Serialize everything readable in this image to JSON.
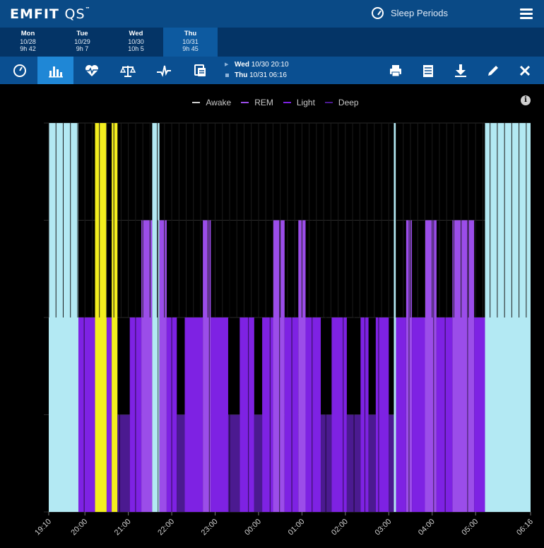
{
  "app": {
    "logo_main": "EMFIT",
    "logo_sub": "QS",
    "logo_tm": "™"
  },
  "header": {
    "periods_label": "Sleep Periods"
  },
  "days": [
    {
      "name": "Mon",
      "date": "10/28",
      "duration": "9h 42",
      "active": false
    },
    {
      "name": "Tue",
      "date": "10/29",
      "duration": "9h 7",
      "active": false
    },
    {
      "name": "Wed",
      "date": "10/30",
      "duration": "10h 5",
      "active": false
    },
    {
      "name": "Thu",
      "date": "10/31",
      "duration": "9h 45",
      "active": true
    }
  ],
  "toolbar": {
    "tools": [
      {
        "icon": "dashboard-gauge-icon",
        "active": false
      },
      {
        "icon": "bar-chart-icon",
        "active": true
      },
      {
        "icon": "heart-rate-icon",
        "active": false
      },
      {
        "icon": "balance-scale-icon",
        "active": false
      },
      {
        "icon": "hrv-wave-icon",
        "active": false
      },
      {
        "icon": "compare-icon",
        "active": false
      }
    ],
    "range": {
      "start": "Wed 10/30 20:10",
      "end": "Thu 10/31 06:16",
      "start_day": "Wed",
      "start_rest": "10/30 20:10",
      "end_day": "Thu",
      "end_rest": "10/31 06:16"
    },
    "actions": [
      "print-icon",
      "notes-icon",
      "download-icon",
      "edit-icon",
      "close-icon"
    ]
  },
  "colors": {
    "awake": "#b3e9f3",
    "rem": "#9b4de9",
    "light": "#7e22e3",
    "deep": "#4b1a90",
    "move": "#f3ee1e",
    "header": "#0a4a86",
    "days_bg": "#043466",
    "active_tool": "#1f87d6"
  },
  "chart_data": {
    "type": "bar",
    "legend": [
      "Awake",
      "REM",
      "Light",
      "Deep"
    ],
    "legend_position": "top-center",
    "x_ticks": [
      "19:10",
      "20:00",
      "21:00",
      "22:00",
      "23:00",
      "00:00",
      "01:00",
      "02:00",
      "03:00",
      "04:00",
      "05:00",
      "06:16"
    ],
    "x_range": [
      "19:10",
      "06:16"
    ],
    "stage_levels": {
      "awake": 4,
      "rem": 3,
      "light": 2,
      "deep": 1
    },
    "grid": true,
    "segments": [
      {
        "start": "19:10",
        "end": "19:51",
        "stage": "awake"
      },
      {
        "start": "19:51",
        "end": "20:14",
        "stage": "light"
      },
      {
        "start": "20:14",
        "end": "20:30",
        "stage": "movement"
      },
      {
        "start": "20:30",
        "end": "20:37",
        "stage": "light"
      },
      {
        "start": "20:37",
        "end": "20:45",
        "stage": "movement"
      },
      {
        "start": "20:45",
        "end": "21:02",
        "stage": "deep"
      },
      {
        "start": "21:02",
        "end": "21:18",
        "stage": "light"
      },
      {
        "start": "21:18",
        "end": "21:33",
        "stage": "rem"
      },
      {
        "start": "21:33",
        "end": "21:43",
        "stage": "awake"
      },
      {
        "start": "21:43",
        "end": "21:53",
        "stage": "rem"
      },
      {
        "start": "21:53",
        "end": "22:07",
        "stage": "light"
      },
      {
        "start": "22:07",
        "end": "22:18",
        "stage": "deep"
      },
      {
        "start": "22:18",
        "end": "22:43",
        "stage": "light"
      },
      {
        "start": "22:43",
        "end": "22:54",
        "stage": "rem"
      },
      {
        "start": "22:54",
        "end": "23:18",
        "stage": "light"
      },
      {
        "start": "23:18",
        "end": "23:34",
        "stage": "deep"
      },
      {
        "start": "23:34",
        "end": "23:54",
        "stage": "light"
      },
      {
        "start": "23:54",
        "end": "24:05",
        "stage": "deep"
      },
      {
        "start": "24:05",
        "end": "24:20",
        "stage": "light"
      },
      {
        "start": "24:20",
        "end": "24:36",
        "stage": "rem"
      },
      {
        "start": "24:36",
        "end": "24:55",
        "stage": "light"
      },
      {
        "start": "24:55",
        "end": "25:05",
        "stage": "rem"
      },
      {
        "start": "25:05",
        "end": "25:26",
        "stage": "light"
      },
      {
        "start": "25:26",
        "end": "25:41",
        "stage": "deep"
      },
      {
        "start": "25:41",
        "end": "26:02",
        "stage": "light"
      },
      {
        "start": "26:02",
        "end": "26:21",
        "stage": "deep"
      },
      {
        "start": "26:21",
        "end": "26:32",
        "stage": "light"
      },
      {
        "start": "26:32",
        "end": "26:42",
        "stage": "deep"
      },
      {
        "start": "26:42",
        "end": "27:00",
        "stage": "light"
      },
      {
        "start": "27:00",
        "end": "27:07",
        "stage": "deep"
      },
      {
        "start": "27:07",
        "end": "27:10",
        "stage": "awake"
      },
      {
        "start": "27:10",
        "end": "27:24",
        "stage": "light"
      },
      {
        "start": "27:24",
        "end": "27:32",
        "stage": "rem"
      },
      {
        "start": "27:32",
        "end": "27:50",
        "stage": "light"
      },
      {
        "start": "27:50",
        "end": "28:06",
        "stage": "rem"
      },
      {
        "start": "28:06",
        "end": "28:28",
        "stage": "light"
      },
      {
        "start": "28:28",
        "end": "28:58",
        "stage": "rem"
      },
      {
        "start": "28:58",
        "end": "29:13",
        "stage": "light"
      },
      {
        "start": "29:13",
        "end": "30:16",
        "stage": "awake"
      }
    ],
    "awake_arousals": [
      "19:59",
      "20:48",
      "21:10",
      "21:41",
      "22:00",
      "22:52",
      "23:20",
      "23:46",
      "24:16",
      "24:29",
      "24:46",
      "25:14",
      "25:33",
      "25:57",
      "26:12",
      "26:27",
      "26:46",
      "27:28",
      "28:02",
      "28:18",
      "28:49"
    ]
  }
}
